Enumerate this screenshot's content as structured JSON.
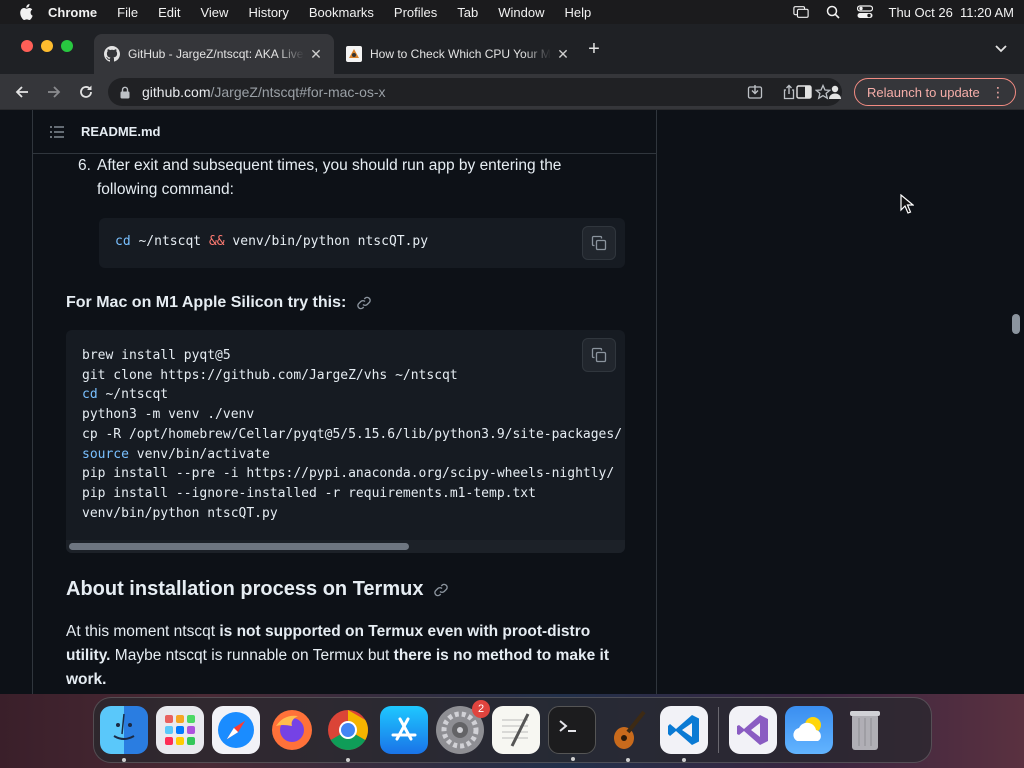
{
  "menubar": {
    "app_name": "Chrome",
    "items": [
      "File",
      "Edit",
      "View",
      "History",
      "Bookmarks",
      "Profiles",
      "Tab",
      "Window",
      "Help"
    ],
    "clock": "Thu Oct 26  11:20 AM"
  },
  "tabs": [
    {
      "title": "GitHub - JargeZ/ntscqt: AKA LiveDrawing",
      "icon": "github-icon",
      "active": true
    },
    {
      "title": "How to Check Which CPU Your Mac Has",
      "icon": "howtogeek-icon",
      "active": false
    }
  ],
  "address_bar": {
    "host": "github.com",
    "path": "/JargeZ/ntscqt#for-mac-os-x"
  },
  "relaunch_label": "Relaunch to update",
  "readme": {
    "header": "README.md",
    "step_number": "6.",
    "step_line1": "After exit and subsequent times, you should run app by entering the",
    "step_line2": "following command:",
    "cmd_small": {
      "cd": "cd",
      "path": " ~/ntscqt ",
      "and": "&&",
      "rest": " venv/bin/python ntscQT.py"
    },
    "mac_m1_heading": "For Mac on M1 Apple Silicon try this:",
    "m1_code_lines": [
      {
        "kw": "",
        "text": "brew install pyqt@5"
      },
      {
        "kw": "",
        "text": "git clone https://github.com/JargeZ/vhs ~/ntscqt"
      },
      {
        "kw": "cd",
        "text": " ~/ntscqt"
      },
      {
        "kw": "",
        "text": "python3 -m venv ./venv"
      },
      {
        "kw": "",
        "text": "cp -R /opt/homebrew/Cellar/pyqt@5/5.15.6/lib/python3.9/site-packages/"
      },
      {
        "kw": "source",
        "text": " venv/bin/activate"
      },
      {
        "kw": "",
        "text": "pip install --pre -i https://pypi.anaconda.org/scipy-wheels-nightly/"
      },
      {
        "kw": "",
        "text": "pip install --ignore-installed -r requirements.m1-temp.txt"
      },
      {
        "kw": "",
        "text": "venv/bin/python ntscQT.py"
      }
    ],
    "termux_heading": "About installation process on Termux",
    "para": {
      "t1": "At this moment ntscqt ",
      "b1": "is not supported on Termux even with proot-distro utility.",
      "t2": " Maybe ntscqt is runnable on Termux but ",
      "b2": "there is no method to make it work."
    }
  },
  "dock": {
    "apps": [
      "Finder",
      "Launchpad",
      "Safari",
      "Firefox",
      "Chrome",
      "App Store",
      "System Settings",
      "TextEdit",
      "Terminal",
      "GarageBand",
      "Visual Studio Code",
      "Visual Studio",
      "Weather",
      "Trash"
    ],
    "settings_badge": "2"
  }
}
